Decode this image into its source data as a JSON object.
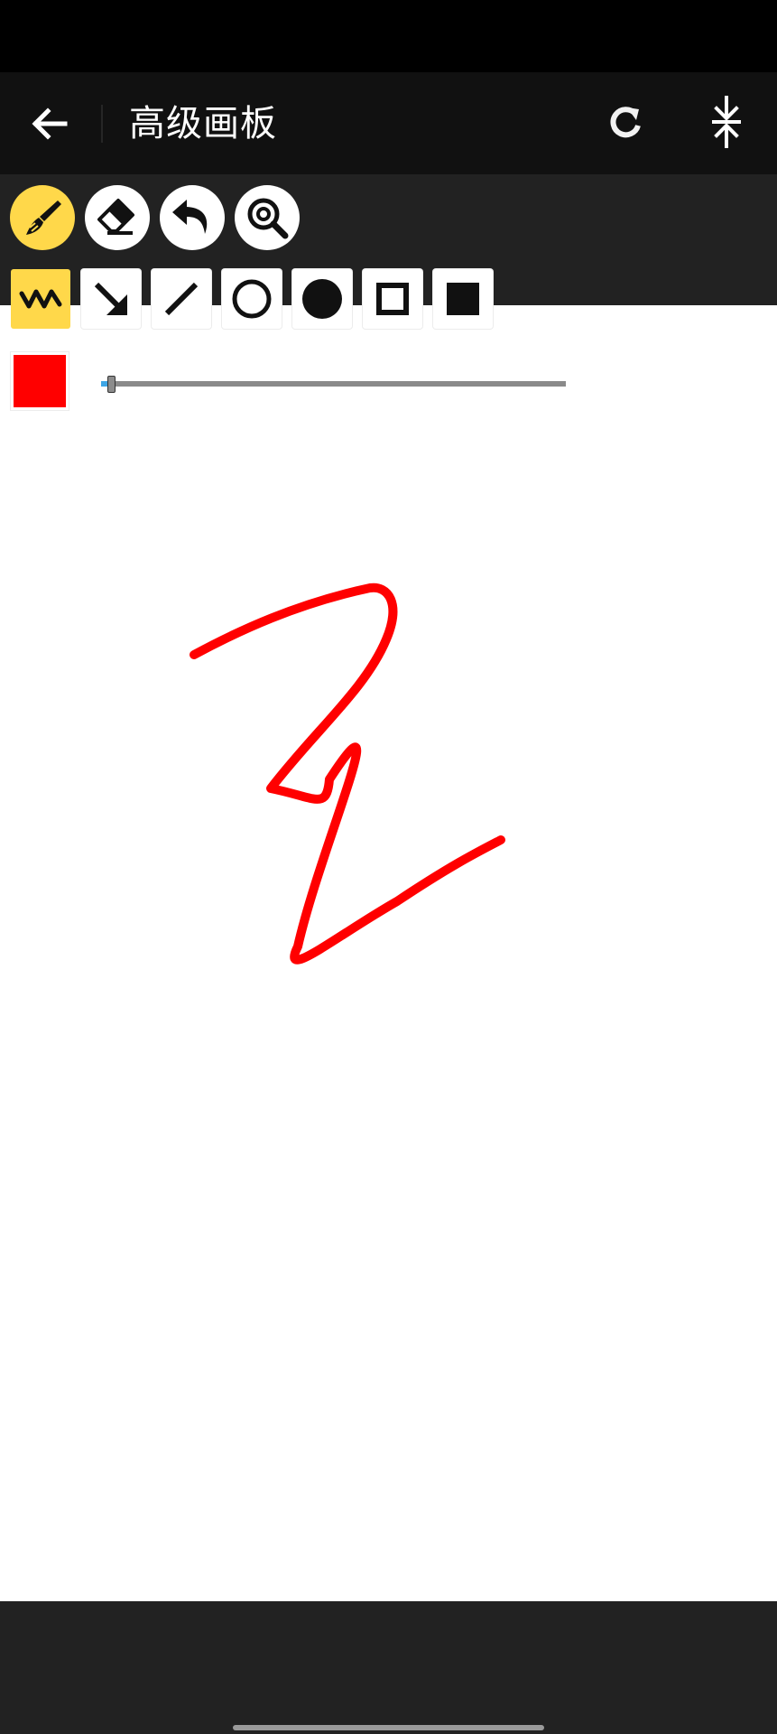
{
  "app": {
    "title": "高级画板"
  },
  "tools": [
    {
      "name": "brush",
      "icon": "brush-icon",
      "active": true
    },
    {
      "name": "eraser",
      "icon": "eraser-icon",
      "active": false
    },
    {
      "name": "undo",
      "icon": "undo-icon",
      "active": false
    },
    {
      "name": "zoom",
      "icon": "zoom-icon",
      "active": false
    }
  ],
  "shapes": [
    {
      "name": "freehand",
      "icon": "freehand-wave-icon",
      "active": true
    },
    {
      "name": "arrow",
      "icon": "arrow-icon",
      "active": false
    },
    {
      "name": "line",
      "icon": "line-icon",
      "active": false
    },
    {
      "name": "hollow-circle",
      "icon": "hollow-circle-icon",
      "active": false
    },
    {
      "name": "filled-circle",
      "icon": "filled-circle-icon",
      "active": false
    },
    {
      "name": "hollow-rectangle",
      "icon": "hollow-square-icon",
      "active": false
    },
    {
      "name": "filled-rectangle",
      "icon": "filled-square-icon",
      "active": false
    }
  ],
  "pen": {
    "color": "#ff0000",
    "size_fraction": 0.02
  },
  "colors": {
    "accent": "#ffd84a",
    "toolbar_bg": "#222222",
    "app_bar_bg": "#111111",
    "slider_fill": "#3ea6e6"
  }
}
